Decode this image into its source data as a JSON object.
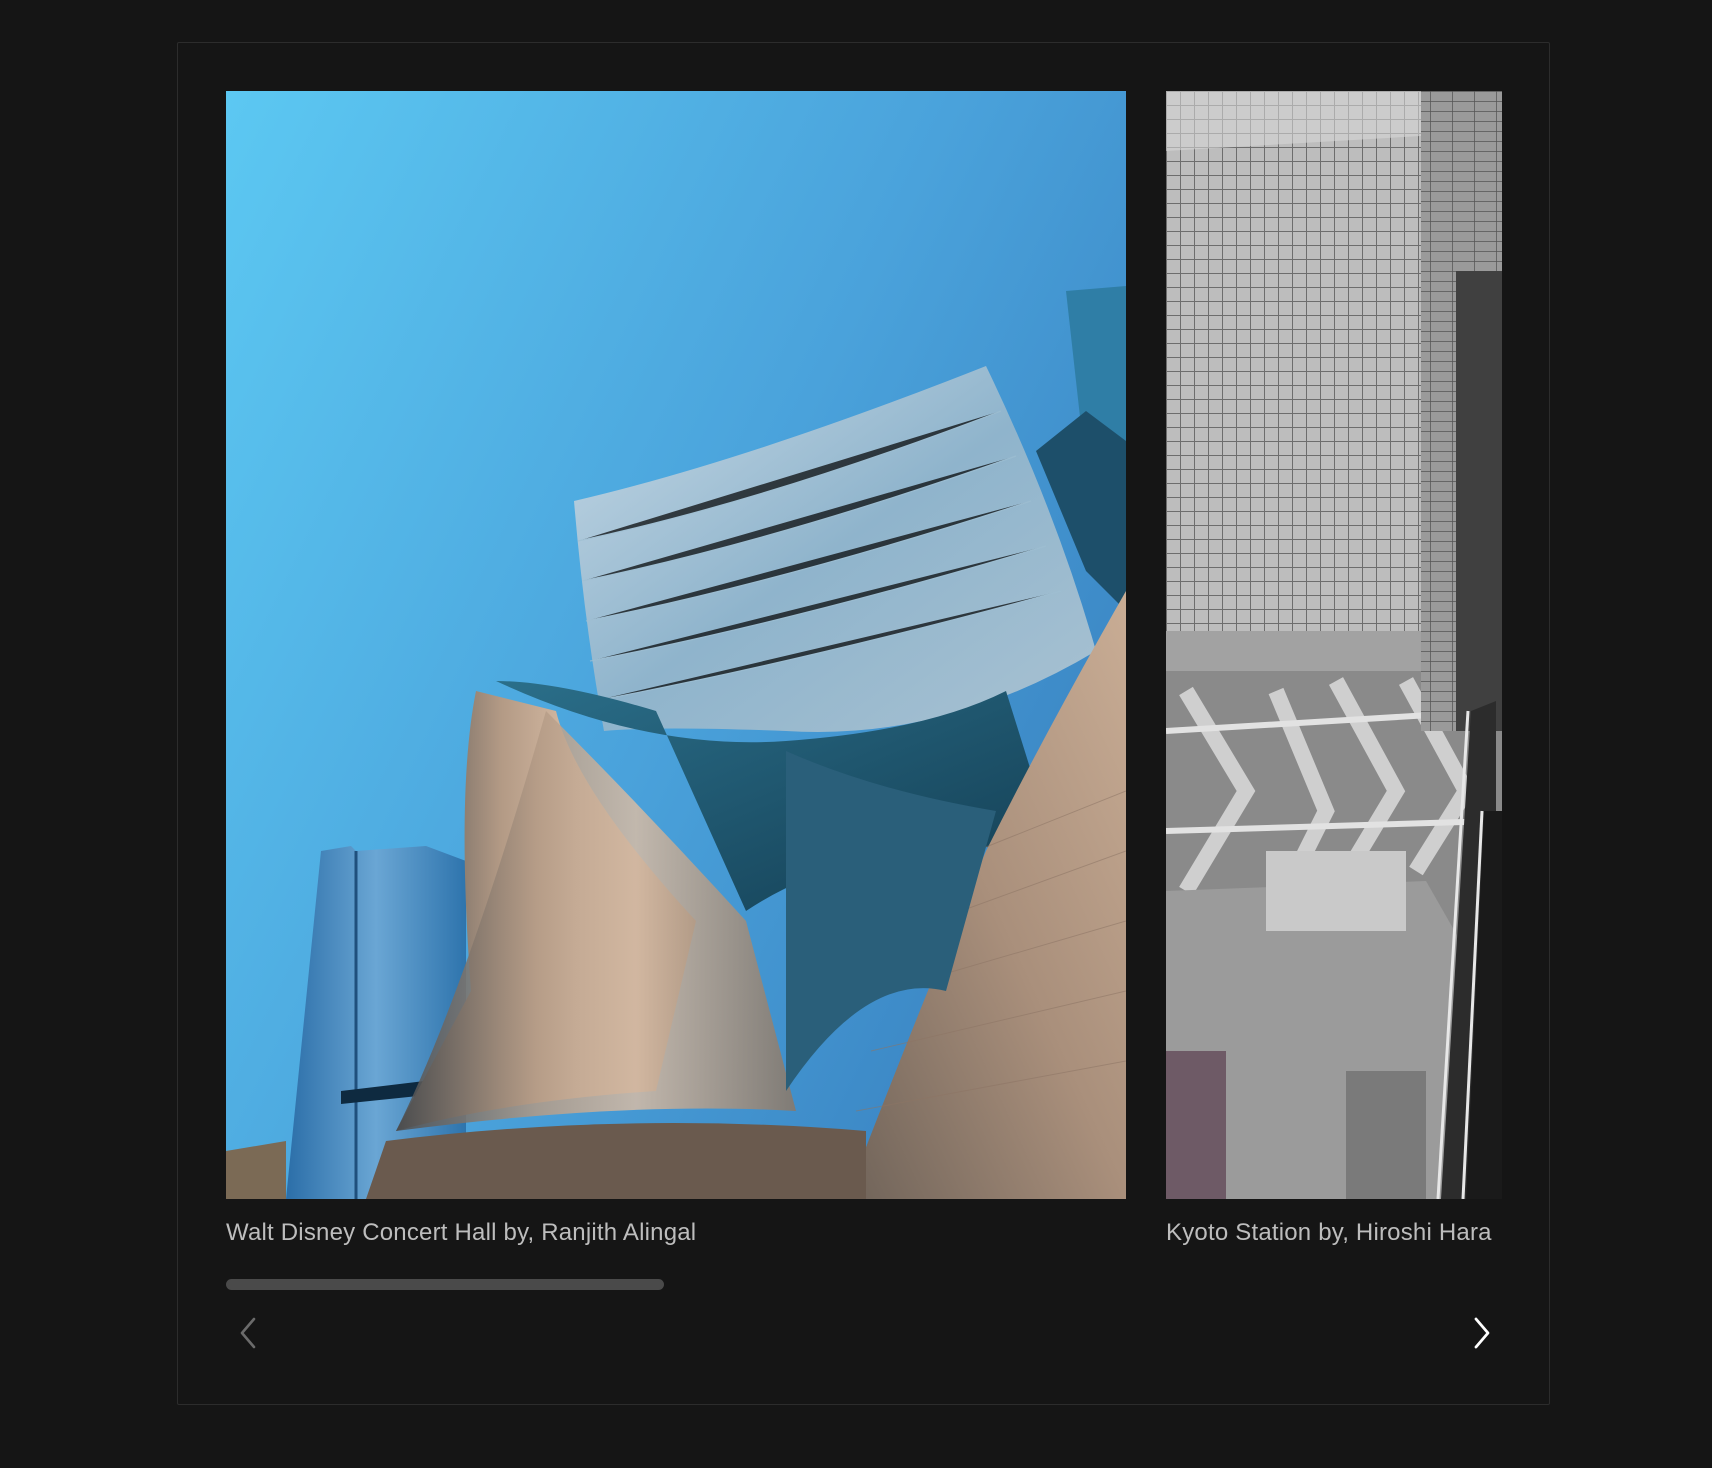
{
  "carousel": {
    "slides": [
      {
        "caption": "Walt Disney Concert Hall by, Ranjith Alingal",
        "image_subject": "stainless-steel curved concert hall facade against blue sky"
      },
      {
        "caption": "Kyoto Station by, Hiroshi Hara",
        "image_subject": "steel lattice atrium with escalators"
      }
    ],
    "progress_fraction": 0.343,
    "prev_icon": "chevron-left-icon",
    "next_icon": "chevron-right-icon",
    "prev_disabled": true,
    "colors": {
      "background": "#151515",
      "border": "#2c2c2c",
      "caption": "#bdbdbd",
      "progress": "#4a4a4a",
      "prev_icon": "#6b6b6b",
      "next_icon": "#ffffff"
    }
  }
}
